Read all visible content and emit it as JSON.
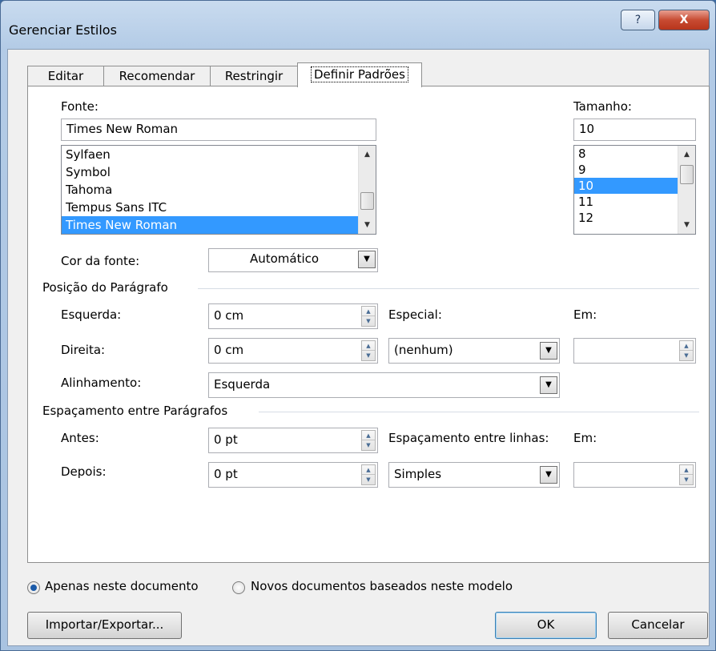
{
  "window": {
    "title": "Gerenciar Estilos",
    "help_glyph": "?",
    "close_glyph": "X"
  },
  "tabs": [
    {
      "label": "Editar"
    },
    {
      "label": "Recomendar"
    },
    {
      "label": "Restringir"
    },
    {
      "label": "Definir Padrões",
      "active": true
    }
  ],
  "font": {
    "label": "Fonte:",
    "value": "Times New Roman",
    "items": [
      "Sylfaen",
      "Symbol",
      "Tahoma",
      "Tempus Sans ITC",
      "Times New Roman"
    ],
    "selected": "Times New Roman"
  },
  "size": {
    "label": "Tamanho:",
    "value": "10",
    "items": [
      "8",
      "9",
      "10",
      "11",
      "12"
    ],
    "selected": "10"
  },
  "font_color": {
    "label": "Cor da fonte:",
    "value": "Automático"
  },
  "paragraph_position": {
    "title": "Posição do Parágrafo",
    "left_label": "Esquerda:",
    "left_value": "0 cm",
    "right_label": "Direita:",
    "right_value": "0 cm",
    "special_label": "Especial:",
    "special_value": "(nenhum)",
    "em_label": "Em:",
    "em_value": "",
    "align_label": "Alinhamento:",
    "align_value": "Esquerda"
  },
  "paragraph_spacing": {
    "title": "Espaçamento entre Parágrafos",
    "before_label": "Antes:",
    "before_value": "0 pt",
    "after_label": "Depois:",
    "after_value": "0 pt",
    "line_label": "Espaçamento entre linhas:",
    "line_value": "Simples",
    "em_label": "Em:",
    "em_value": ""
  },
  "scope": {
    "option1": "Apenas neste documento",
    "option2": "Novos documentos baseados neste modelo",
    "selected": "option1"
  },
  "buttons": {
    "import_export": "Importar/Exportar...",
    "ok": "OK",
    "cancel": "Cancelar"
  }
}
